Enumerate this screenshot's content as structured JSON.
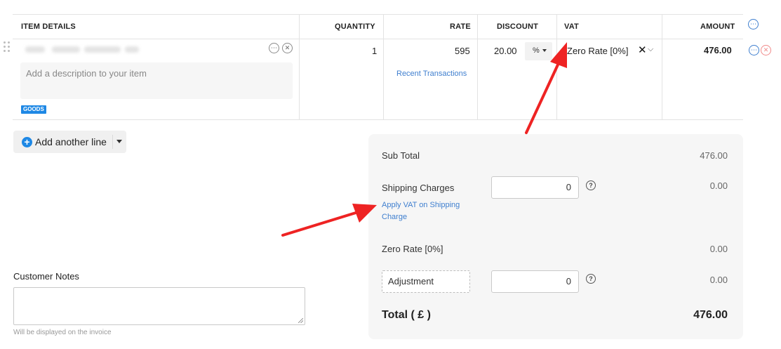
{
  "table": {
    "headers": {
      "item_details": "ITEM DETAILS",
      "quantity": "QUANTITY",
      "rate": "RATE",
      "discount": "DISCOUNT",
      "vat": "VAT",
      "amount": "AMOUNT"
    },
    "row": {
      "description_placeholder": "Add a description to your item",
      "item_type_badge": "GOODS",
      "quantity": "1",
      "rate": "595",
      "recent_transactions_link": "Recent Transactions",
      "discount": "20.00",
      "discount_unit": "%",
      "vat": "Zero Rate [0%]",
      "amount": "476.00"
    }
  },
  "actions": {
    "add_line_label": "Add another line"
  },
  "notes": {
    "label": "Customer Notes",
    "value": "",
    "help": "Will be displayed on the invoice"
  },
  "totals": {
    "sub_total_label": "Sub Total",
    "sub_total_value": "476.00",
    "shipping_label": "Shipping Charges",
    "shipping_input": "0",
    "shipping_value": "0.00",
    "apply_vat_link": "Apply VAT on Shipping Charge",
    "tax_label": "Zero Rate [0%]",
    "tax_value": "0.00",
    "adjustment_label": "Adjustment",
    "adjustment_input": "0",
    "adjustment_value": "0.00",
    "total_label": "Total ( £ )",
    "total_value": "476.00"
  },
  "icons": {
    "more": "more-options-icon",
    "remove": "remove-icon",
    "help": "help-icon",
    "add": "plus-icon"
  },
  "colors": {
    "accent": "#1e88e5",
    "link": "#3f7fcf",
    "annotation_arrow": "#ee2323",
    "remove_icon": "#f08a8a"
  }
}
